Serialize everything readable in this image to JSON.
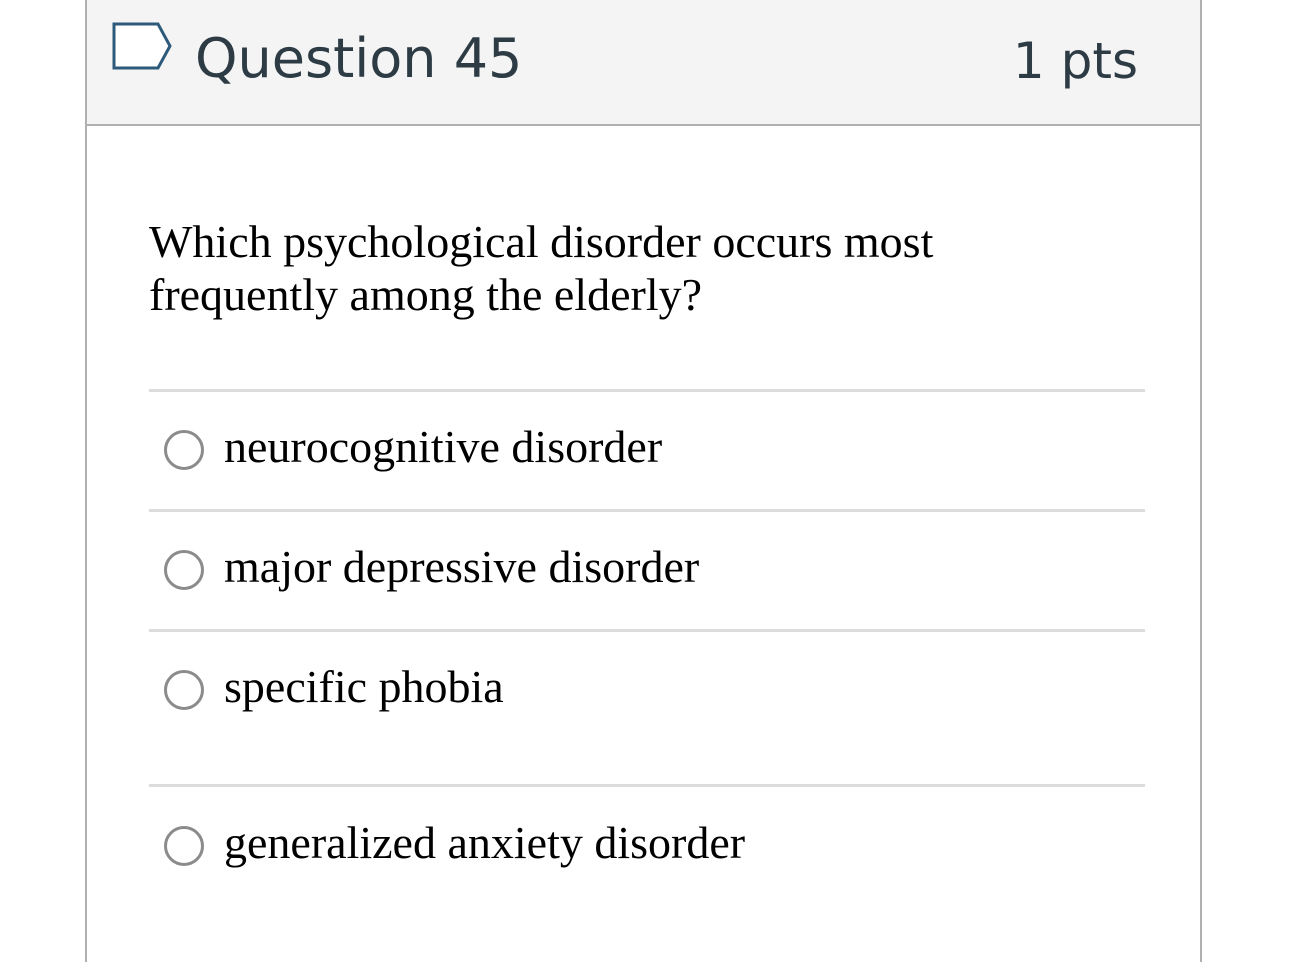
{
  "header": {
    "title": "Question 45",
    "points": "1 pts",
    "flag_icon": "flag-bookmark-icon"
  },
  "question": {
    "text": "Which psychological disorder occurs most frequently among the elderly?"
  },
  "answers": [
    {
      "label": "neurocognitive disorder",
      "selected": false
    },
    {
      "label": "major depressive disorder",
      "selected": false
    },
    {
      "label": "specific phobia",
      "selected": false
    },
    {
      "label": "generalized anxiety disorder",
      "selected": false
    }
  ],
  "colors": {
    "header_bg": "#f4f4f4",
    "border": "#b0b0b0",
    "title_text": "#2d3b45",
    "flag_outline": "#2d5a7b",
    "radio_border": "#8b8b8b",
    "divider": "#dcdcdc"
  }
}
